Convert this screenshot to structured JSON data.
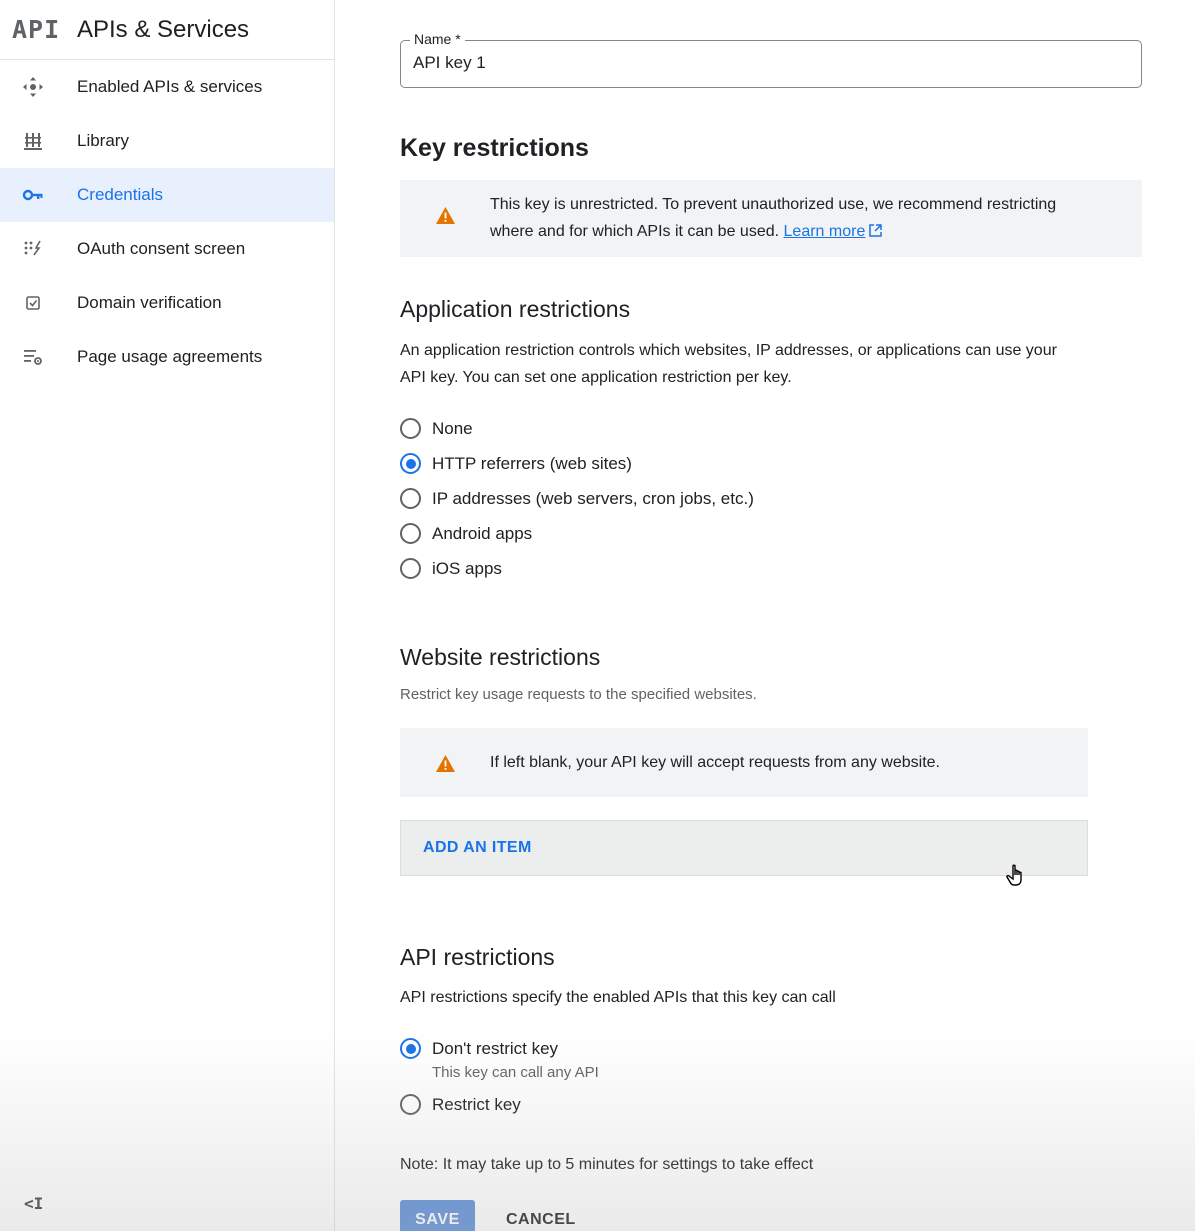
{
  "sidebar": {
    "logo": "API",
    "title": "APIs & Services",
    "items": [
      {
        "label": "Enabled APIs & services",
        "icon": "enabled-apis-icon"
      },
      {
        "label": "Library",
        "icon": "library-icon"
      },
      {
        "label": "Credentials",
        "icon": "key-icon",
        "active": true
      },
      {
        "label": "OAuth consent screen",
        "icon": "oauth-icon"
      },
      {
        "label": "Domain verification",
        "icon": "domain-check-icon"
      },
      {
        "label": "Page usage agreements",
        "icon": "page-settings-icon"
      }
    ],
    "collapse_label": "<I"
  },
  "name_field": {
    "label": "Name *",
    "value": "API key 1"
  },
  "key_restrictions": {
    "heading": "Key restrictions",
    "warning_line1": "This key is unrestricted. To prevent unauthorized use, we recommend restricting",
    "warning_line2": "where and for which APIs it can be used.",
    "learn_more": "Learn more"
  },
  "application_restrictions": {
    "heading": "Application restrictions",
    "description_line1": "An application restriction controls which websites, IP addresses, or applications can use your",
    "description_line2": "API key. You can set one application restriction per key.",
    "options": [
      {
        "label": "None",
        "selected": false
      },
      {
        "label": "HTTP referrers (web sites)",
        "selected": true
      },
      {
        "label": "IP addresses (web servers, cron jobs, etc.)",
        "selected": false
      },
      {
        "label": "Android apps",
        "selected": false
      },
      {
        "label": "iOS apps",
        "selected": false
      }
    ]
  },
  "website_restrictions": {
    "heading": "Website restrictions",
    "description": "Restrict key usage requests to the specified websites.",
    "warning": "If left blank, your API key will accept requests from any website.",
    "add_item": "ADD AN ITEM"
  },
  "api_restrictions": {
    "heading": "API restrictions",
    "description": "API restrictions specify the enabled APIs that this key can call",
    "options": [
      {
        "label": "Don't restrict key",
        "sublabel": "This key can call any API",
        "selected": true
      },
      {
        "label": "Restrict key",
        "selected": false
      }
    ]
  },
  "note": "Note: It may take up to 5 minutes for settings to take effect",
  "actions": {
    "save": "SAVE",
    "cancel": "CANCEL"
  },
  "colors": {
    "accent": "#1a73e8",
    "warning": "#e37400",
    "active_nav_bg": "#e8f0fe"
  }
}
